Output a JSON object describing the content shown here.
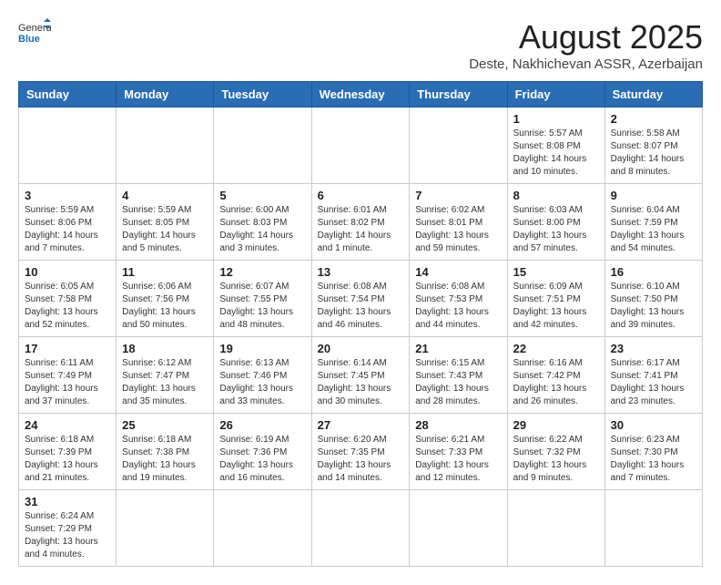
{
  "logo": {
    "text_general": "General",
    "text_blue": "Blue"
  },
  "title": "August 2025",
  "subtitle": "Deste, Nakhichevan ASSR, Azerbaijan",
  "days_of_week": [
    "Sunday",
    "Monday",
    "Tuesday",
    "Wednesday",
    "Thursday",
    "Friday",
    "Saturday"
  ],
  "weeks": [
    [
      {
        "day": "",
        "info": ""
      },
      {
        "day": "",
        "info": ""
      },
      {
        "day": "",
        "info": ""
      },
      {
        "day": "",
        "info": ""
      },
      {
        "day": "",
        "info": ""
      },
      {
        "day": "1",
        "info": "Sunrise: 5:57 AM\nSunset: 8:08 PM\nDaylight: 14 hours and 10 minutes."
      },
      {
        "day": "2",
        "info": "Sunrise: 5:58 AM\nSunset: 8:07 PM\nDaylight: 14 hours and 8 minutes."
      }
    ],
    [
      {
        "day": "3",
        "info": "Sunrise: 5:59 AM\nSunset: 8:06 PM\nDaylight: 14 hours and 7 minutes."
      },
      {
        "day": "4",
        "info": "Sunrise: 5:59 AM\nSunset: 8:05 PM\nDaylight: 14 hours and 5 minutes."
      },
      {
        "day": "5",
        "info": "Sunrise: 6:00 AM\nSunset: 8:03 PM\nDaylight: 14 hours and 3 minutes."
      },
      {
        "day": "6",
        "info": "Sunrise: 6:01 AM\nSunset: 8:02 PM\nDaylight: 14 hours and 1 minute."
      },
      {
        "day": "7",
        "info": "Sunrise: 6:02 AM\nSunset: 8:01 PM\nDaylight: 13 hours and 59 minutes."
      },
      {
        "day": "8",
        "info": "Sunrise: 6:03 AM\nSunset: 8:00 PM\nDaylight: 13 hours and 57 minutes."
      },
      {
        "day": "9",
        "info": "Sunrise: 6:04 AM\nSunset: 7:59 PM\nDaylight: 13 hours and 54 minutes."
      }
    ],
    [
      {
        "day": "10",
        "info": "Sunrise: 6:05 AM\nSunset: 7:58 PM\nDaylight: 13 hours and 52 minutes."
      },
      {
        "day": "11",
        "info": "Sunrise: 6:06 AM\nSunset: 7:56 PM\nDaylight: 13 hours and 50 minutes."
      },
      {
        "day": "12",
        "info": "Sunrise: 6:07 AM\nSunset: 7:55 PM\nDaylight: 13 hours and 48 minutes."
      },
      {
        "day": "13",
        "info": "Sunrise: 6:08 AM\nSunset: 7:54 PM\nDaylight: 13 hours and 46 minutes."
      },
      {
        "day": "14",
        "info": "Sunrise: 6:08 AM\nSunset: 7:53 PM\nDaylight: 13 hours and 44 minutes."
      },
      {
        "day": "15",
        "info": "Sunrise: 6:09 AM\nSunset: 7:51 PM\nDaylight: 13 hours and 42 minutes."
      },
      {
        "day": "16",
        "info": "Sunrise: 6:10 AM\nSunset: 7:50 PM\nDaylight: 13 hours and 39 minutes."
      }
    ],
    [
      {
        "day": "17",
        "info": "Sunrise: 6:11 AM\nSunset: 7:49 PM\nDaylight: 13 hours and 37 minutes."
      },
      {
        "day": "18",
        "info": "Sunrise: 6:12 AM\nSunset: 7:47 PM\nDaylight: 13 hours and 35 minutes."
      },
      {
        "day": "19",
        "info": "Sunrise: 6:13 AM\nSunset: 7:46 PM\nDaylight: 13 hours and 33 minutes."
      },
      {
        "day": "20",
        "info": "Sunrise: 6:14 AM\nSunset: 7:45 PM\nDaylight: 13 hours and 30 minutes."
      },
      {
        "day": "21",
        "info": "Sunrise: 6:15 AM\nSunset: 7:43 PM\nDaylight: 13 hours and 28 minutes."
      },
      {
        "day": "22",
        "info": "Sunrise: 6:16 AM\nSunset: 7:42 PM\nDaylight: 13 hours and 26 minutes."
      },
      {
        "day": "23",
        "info": "Sunrise: 6:17 AM\nSunset: 7:41 PM\nDaylight: 13 hours and 23 minutes."
      }
    ],
    [
      {
        "day": "24",
        "info": "Sunrise: 6:18 AM\nSunset: 7:39 PM\nDaylight: 13 hours and 21 minutes."
      },
      {
        "day": "25",
        "info": "Sunrise: 6:18 AM\nSunset: 7:38 PM\nDaylight: 13 hours and 19 minutes."
      },
      {
        "day": "26",
        "info": "Sunrise: 6:19 AM\nSunset: 7:36 PM\nDaylight: 13 hours and 16 minutes."
      },
      {
        "day": "27",
        "info": "Sunrise: 6:20 AM\nSunset: 7:35 PM\nDaylight: 13 hours and 14 minutes."
      },
      {
        "day": "28",
        "info": "Sunrise: 6:21 AM\nSunset: 7:33 PM\nDaylight: 13 hours and 12 minutes."
      },
      {
        "day": "29",
        "info": "Sunrise: 6:22 AM\nSunset: 7:32 PM\nDaylight: 13 hours and 9 minutes."
      },
      {
        "day": "30",
        "info": "Sunrise: 6:23 AM\nSunset: 7:30 PM\nDaylight: 13 hours and 7 minutes."
      }
    ],
    [
      {
        "day": "31",
        "info": "Sunrise: 6:24 AM\nSunset: 7:29 PM\nDaylight: 13 hours and 4 minutes."
      },
      {
        "day": "",
        "info": ""
      },
      {
        "day": "",
        "info": ""
      },
      {
        "day": "",
        "info": ""
      },
      {
        "day": "",
        "info": ""
      },
      {
        "day": "",
        "info": ""
      },
      {
        "day": "",
        "info": ""
      }
    ]
  ]
}
